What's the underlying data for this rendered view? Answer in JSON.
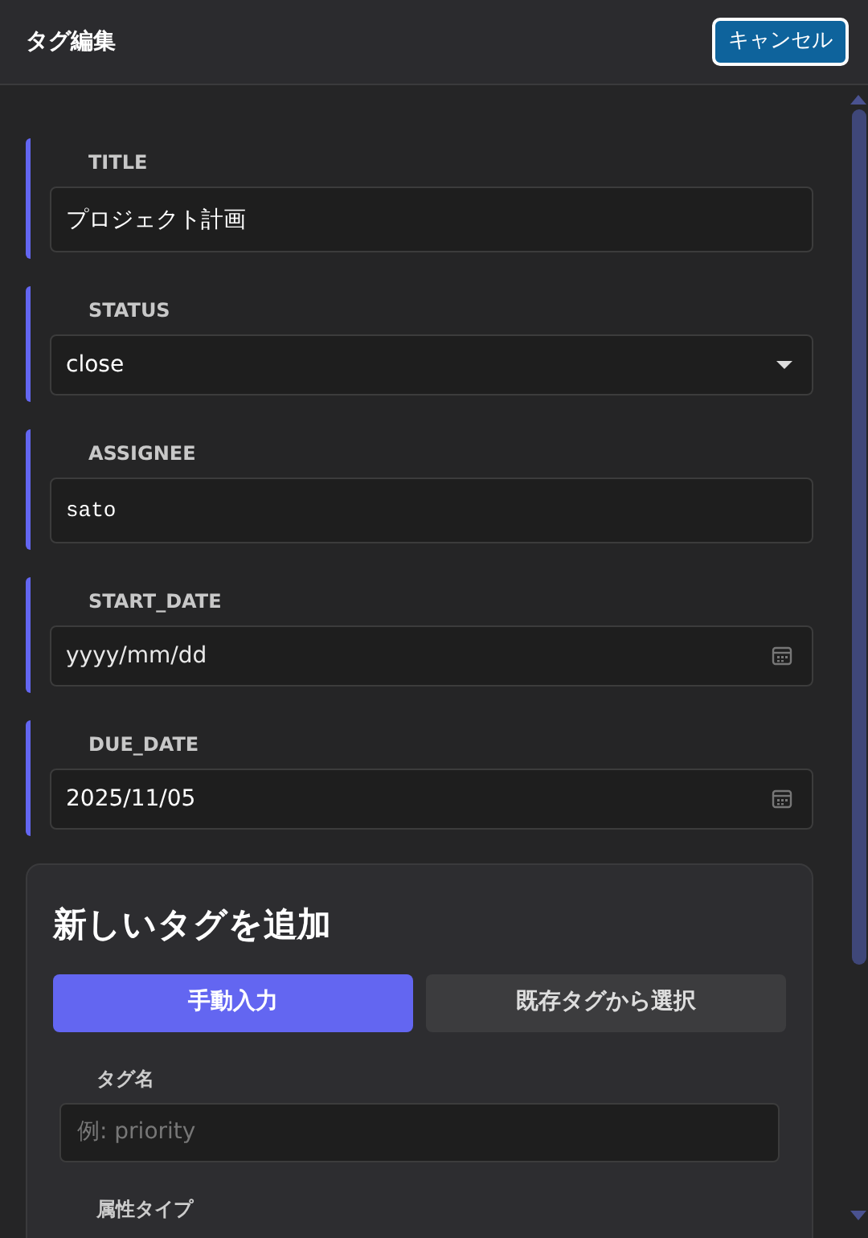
{
  "header": {
    "title": "タグ編集",
    "cancel_button": "キャンセル"
  },
  "fields": [
    {
      "label": "TITLE",
      "kind": "text",
      "value": "プロジェクト計画"
    },
    {
      "label": "STATUS",
      "kind": "select",
      "value": "close"
    },
    {
      "label": "ASSIGNEE",
      "kind": "code",
      "value": "sato"
    },
    {
      "label": "START_DATE",
      "kind": "date",
      "placeholder": "yyyy/mm/dd"
    },
    {
      "label": "DUE_DATE",
      "kind": "date",
      "value": "2025/11/05"
    }
  ],
  "new_tag": {
    "heading": "新しいタグを追加",
    "modes": [
      {
        "label": "手動入力",
        "selected": true
      },
      {
        "label": "既存タグから選択",
        "selected": false
      }
    ],
    "name_label": "タグ名",
    "name_placeholder": "例: priority",
    "type_label": "属性タイプ"
  }
}
